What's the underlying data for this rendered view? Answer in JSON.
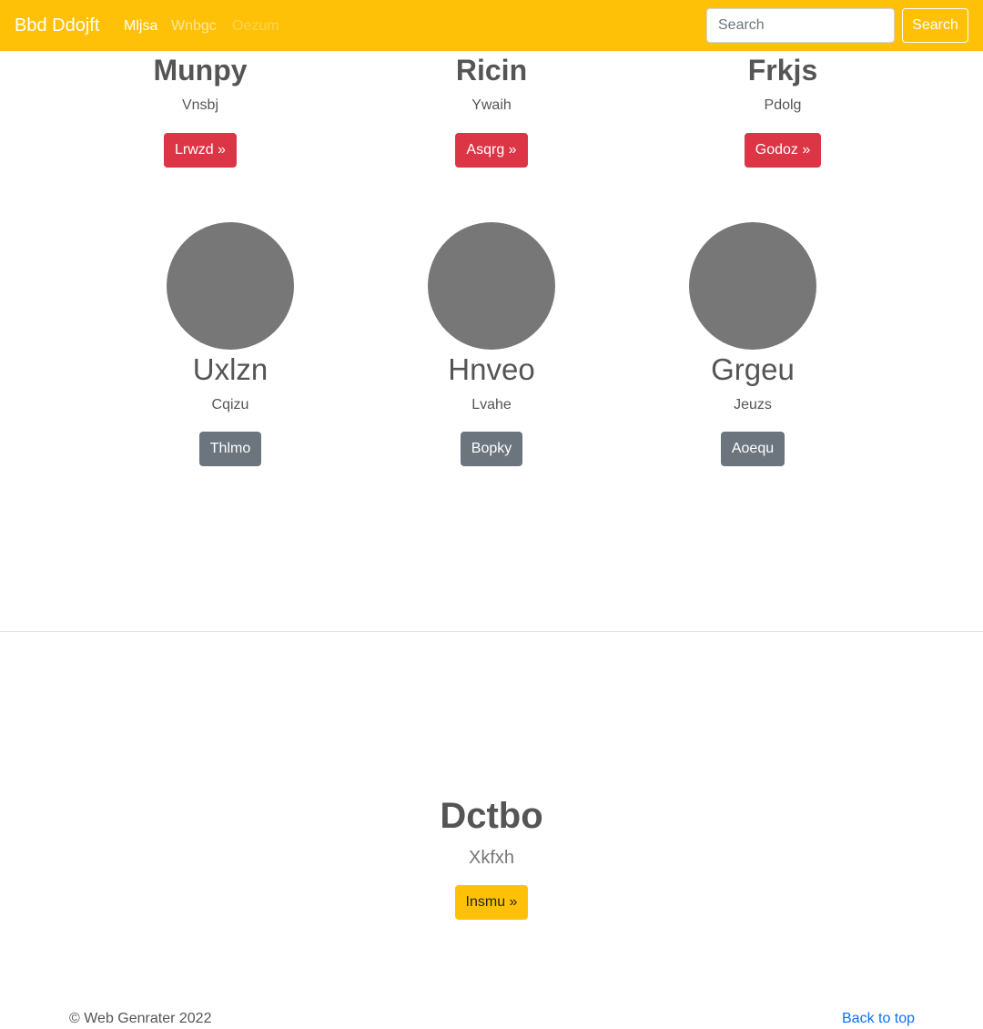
{
  "navbar": {
    "brand": "Bbd Ddojft",
    "links": [
      "Mljsa",
      "Wnbgc",
      "Oezum"
    ],
    "search": {
      "placeholder": "Search",
      "button_label": "Search"
    }
  },
  "top_row": [
    {
      "title": "Munpy",
      "subtitle": "Vnsbj",
      "button": "Lrwzd »"
    },
    {
      "title": "Ricin",
      "subtitle": "Ywaih",
      "button": "Asqrg »"
    },
    {
      "title": "Frkjs",
      "subtitle": "Pdolg",
      "button": "Godoz »"
    }
  ],
  "circle_row": [
    {
      "title": "Uxlzn",
      "subtitle": "Cqizu",
      "button": "Thlmo"
    },
    {
      "title": "Hnveo",
      "subtitle": "Lvahe",
      "button": "Bopky"
    },
    {
      "title": "Grgeu",
      "subtitle": "Jeuzs",
      "button": "Aoequ"
    }
  ],
  "hero": {
    "title": "Dctbo",
    "subtitle": "Xkfxh",
    "button": "Insmu »"
  },
  "footer": {
    "copyright": "© Web Genrater 2022",
    "back_to_top": "Back to top"
  },
  "colors": {
    "navbar": "#ffc107",
    "danger": "#dc3545",
    "secondary": "#6c757d",
    "placeholder_circle": "#777777",
    "link": "#0d6efd"
  }
}
